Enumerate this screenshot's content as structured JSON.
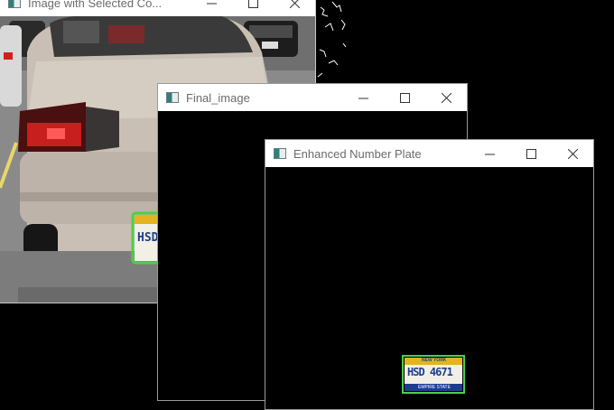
{
  "windows": [
    {
      "id": "w1",
      "title": "Image with Selected Co...",
      "accent": "#4ccf4c"
    },
    {
      "id": "w2",
      "title": "Final_image"
    },
    {
      "id": "w3",
      "title": "Enhanced Number Plate"
    }
  ],
  "controls": {
    "minimize": "minimize-icon",
    "maximize": "maximize-icon",
    "close": "close-icon"
  },
  "plate": {
    "number": "HSD 4671",
    "number_partial": "HSD",
    "top_text": "NEW YORK",
    "bottom_text": "EMPIRE STATE",
    "colors": {
      "bg": "#f2f0e6",
      "band": "#e4b31f",
      "text": "#1f3d8f",
      "outline": "#4ccf4c"
    }
  }
}
